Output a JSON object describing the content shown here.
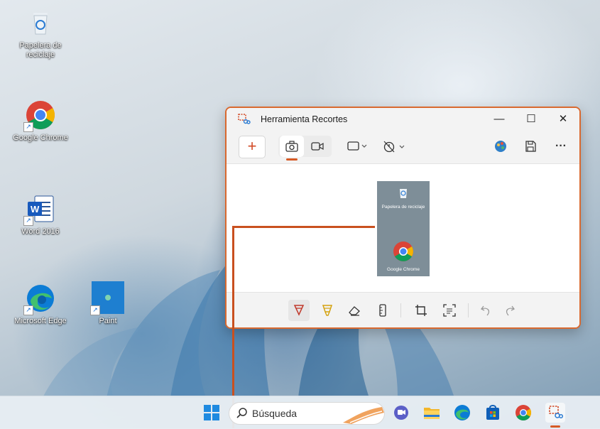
{
  "desktop": {
    "icons": [
      {
        "id": "recycle",
        "label": "Papelera de reciclaje"
      },
      {
        "id": "chrome",
        "label": "Google Chrome"
      },
      {
        "id": "word",
        "label": "Word 2016",
        "badge": "W"
      },
      {
        "id": "edge",
        "label": "Microsoft Edge"
      },
      {
        "id": "paint",
        "label": "Paint"
      }
    ]
  },
  "window": {
    "title": "Herramienta Recortes",
    "controls": {
      "minimize": "—",
      "maximize": "☐",
      "close": "✕"
    },
    "toolbar": {
      "new_label": "+",
      "more_label": "···",
      "icons": [
        "new-snip-icon",
        "camera-icon",
        "video-icon",
        "rectangle-mode-icon",
        "timer-icon",
        "paint-palette-icon",
        "save-icon",
        "more-icon"
      ]
    },
    "capture": {
      "icons": [
        {
          "label": "Papelera de reciclaje"
        },
        {
          "label": "Google Chrome"
        }
      ]
    },
    "bottom_tools": [
      "ballpoint-pen-icon",
      "highlighter-icon",
      "eraser-icon",
      "ruler-icon",
      "crop-icon",
      "text-actions-icon",
      "undo-icon",
      "redo-icon"
    ]
  },
  "taskbar": {
    "search_placeholder": "Búsqueda",
    "icons": [
      "start-icon",
      "search-icon",
      "teams-chat-icon",
      "file-explorer-icon",
      "edge-icon",
      "store-icon",
      "chrome-icon",
      "snipping-tool-icon"
    ]
  },
  "colors": {
    "accent": "#d65a25",
    "window_border": "#d9692f",
    "annotation": "#c9501f"
  }
}
